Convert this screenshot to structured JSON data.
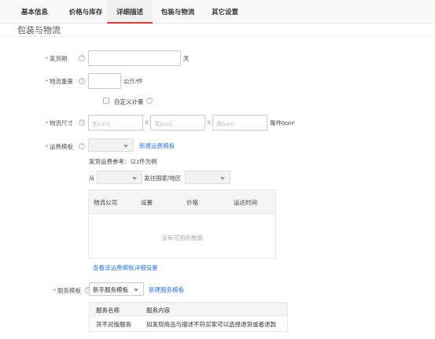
{
  "tabs": [
    {
      "label": "基本信息"
    },
    {
      "label": "价格与库存"
    },
    {
      "label": "详细描述"
    },
    {
      "label": "包装与物流"
    },
    {
      "label": "其它设置"
    }
  ],
  "section_title": "包装与物流",
  "form": {
    "required_mark": "*",
    "help_glyph": "?",
    "ship_period": {
      "label": "发货期",
      "value": "",
      "unit": "天"
    },
    "logistics_weight": {
      "label": "物流重量",
      "value": "",
      "unit": "公斤/件"
    },
    "custom_weight": {
      "label": "自定义计量",
      "checked": false
    },
    "dimensions": {
      "label": "物流尺寸",
      "length_placeholder": "长(cm)",
      "width_placeholder": "宽(cm)",
      "height_placeholder": "高(cm)",
      "separator": "X",
      "volume_text": "每件0cm³"
    },
    "shipping_template": {
      "label": "运费模板",
      "selected": "",
      "new_link": "新建运费模板",
      "reference_text": "发货运费参考：以1件为例",
      "from_label": "从",
      "from_selected": "",
      "to_label": "发往国家/地区",
      "to_selected": "",
      "table": {
        "columns": [
          "物流公司",
          "设置",
          "价格",
          "运达时间"
        ],
        "empty_text": "没有可用的数据"
      },
      "detail_link": "查看该运费模板详细设置"
    },
    "service_template": {
      "label": "服务模板",
      "selected": "新手服务模板",
      "new_link": "新建服务模板",
      "table": {
        "columns": [
          "服务名称",
          "服务内容"
        ],
        "rows": [
          [
            "货不对版服务",
            "如发现商品与描述不符买家可以选择退货或者退款"
          ]
        ]
      }
    }
  },
  "colors": {
    "accent": "#e4393c",
    "link": "#2c7be5"
  }
}
